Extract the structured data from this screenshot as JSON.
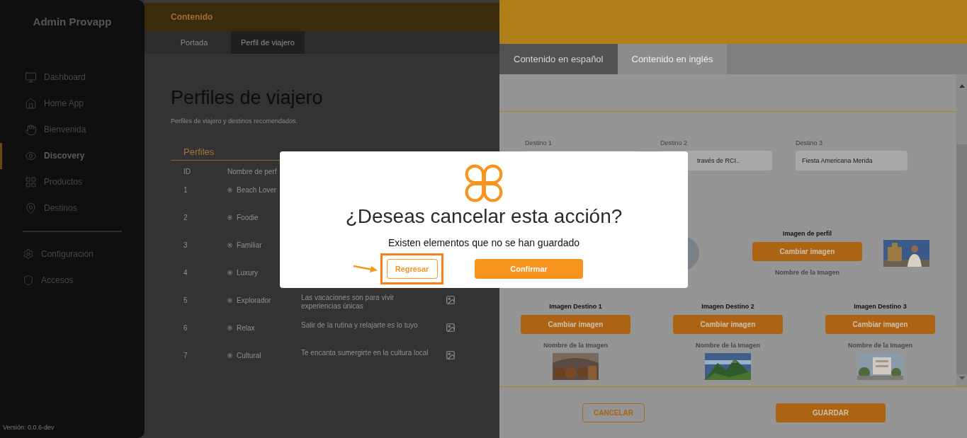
{
  "sidebar": {
    "title": "Admin Provapp",
    "items": [
      {
        "label": "Dashboard",
        "selected": false
      },
      {
        "label": "Home App",
        "selected": false
      },
      {
        "label": "Bienvenida",
        "selected": false
      },
      {
        "label": "Discovery",
        "selected": true
      },
      {
        "label": "Productos",
        "selected": false
      },
      {
        "label": "Destinos",
        "selected": false
      }
    ],
    "settings_items": [
      {
        "label": "Configuración"
      },
      {
        "label": "Accesos"
      }
    ],
    "version": "Versión: 0.0.6-dev"
  },
  "main": {
    "header": "Contenido",
    "tabs": [
      {
        "label": "Portada",
        "selected": false
      },
      {
        "label": "Perfil de viajero",
        "selected": true
      }
    ],
    "title": "Perfiles de viajero",
    "subtitle": "Perfiles de viajero y destinos recomendados.",
    "section": "Perfiles",
    "table": {
      "columns": [
        "ID",
        "Nombre de perf"
      ],
      "rows": [
        {
          "id": "1",
          "name": "Beach Lover"
        },
        {
          "id": "2",
          "name": "Foodie"
        },
        {
          "id": "3",
          "name": "Familiar"
        },
        {
          "id": "4",
          "name": "Luxury"
        },
        {
          "id": "5",
          "name": "Explorador",
          "description": "Las vacaciones son para vivir experiencias únicas"
        },
        {
          "id": "6",
          "name": "Relax",
          "description": "Salir de la rutina y relajarte es lo tuyo"
        },
        {
          "id": "7",
          "name": "Cultural",
          "description": "Te encanta sumergirte en la cultura local"
        }
      ]
    }
  },
  "panel": {
    "tabs": [
      {
        "label": "Contenido en español",
        "selected": true
      },
      {
        "label": "Contenido en inglés",
        "selected": false
      }
    ],
    "destinations": [
      {
        "label": "Destino 1"
      },
      {
        "label": "Destino 2",
        "value": "través de RCI.."
      },
      {
        "label": "Destino 3",
        "value": "Fiesta Americana Merida"
      }
    ],
    "profile_image": {
      "label": "Imagen de perfil",
      "button": "Cambiar imagen",
      "caption": "Nombre de la Imagen"
    },
    "destination_images": [
      {
        "label": "Imagen Destino 1",
        "button": "Cambiar imagen",
        "caption": "Nombre de la Imagen"
      },
      {
        "label": "Imagen Destino 2",
        "button": "Cambiar imagen",
        "caption": "Nombre de la Imagen"
      },
      {
        "label": "Imagen Destino 3",
        "button": "Cambiar imagen",
        "caption": "Nombre de la Imagen"
      }
    ],
    "footer_buttons": [
      {
        "label": "CANCELAR",
        "kind": "outline"
      },
      {
        "label": "GUARDAR",
        "kind": "filled"
      }
    ]
  },
  "dialog": {
    "title": "¿Deseas cancelar esta acción?",
    "message": "Existen elementos que no se han guardado",
    "buttons": [
      {
        "label": "Regresar",
        "kind": "outline",
        "highlighted": true
      },
      {
        "label": "Confirmar",
        "kind": "filled",
        "highlighted": false
      }
    ]
  }
}
